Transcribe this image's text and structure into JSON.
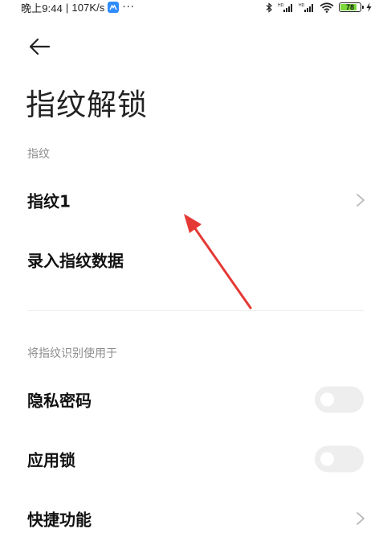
{
  "status_bar": {
    "time": "晚上9:44",
    "separator": "|",
    "speed": "107K/s",
    "more": "···",
    "battery": "78"
  },
  "page": {
    "title": "指纹解锁"
  },
  "sections": {
    "fingerprint": {
      "label": "指纹",
      "items": [
        {
          "label": "指纹1"
        },
        {
          "label": "录入指纹数据"
        }
      ]
    },
    "usage": {
      "label": "将指纹识别使用于",
      "items": [
        {
          "label": "隐私密码",
          "enabled": false
        },
        {
          "label": "应用锁",
          "enabled": false
        },
        {
          "label": "快捷功能"
        }
      ]
    }
  },
  "colors": {
    "accent_arrow": "#e53935",
    "battery_fill": "#7bd93a",
    "app_badge": "#2f8cff",
    "section_label": "#8c8c8c",
    "toggle_off": "#eeeeee"
  },
  "icons": {
    "back": "arrow-left-icon",
    "chevron": "chevron-right-icon",
    "bluetooth": "bluetooth-icon",
    "signal": "signal-icon",
    "wifi": "wifi-icon",
    "charging": "lightning-icon"
  }
}
